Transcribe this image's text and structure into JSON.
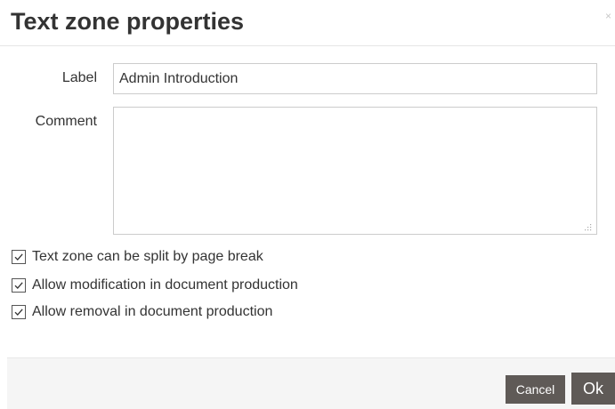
{
  "dialog": {
    "title": "Text zone properties",
    "close_glyph": "×",
    "close_icon": "close-icon"
  },
  "form": {
    "label_caption": "Label",
    "label_value": "Admin Introduction",
    "comment_caption": "Comment",
    "comment_value": ""
  },
  "options": [
    {
      "label": "Text zone can be split by page break",
      "checked": true
    },
    {
      "label": "Allow modification in document production",
      "checked": true
    },
    {
      "label": "Allow removal in document production",
      "checked": true
    }
  ],
  "footer": {
    "cancel_label": "Cancel",
    "ok_label": "Ok"
  },
  "colors": {
    "button_bg": "#5f5a57",
    "footer_bg": "#f5f5f5",
    "border": "#cccccc"
  }
}
